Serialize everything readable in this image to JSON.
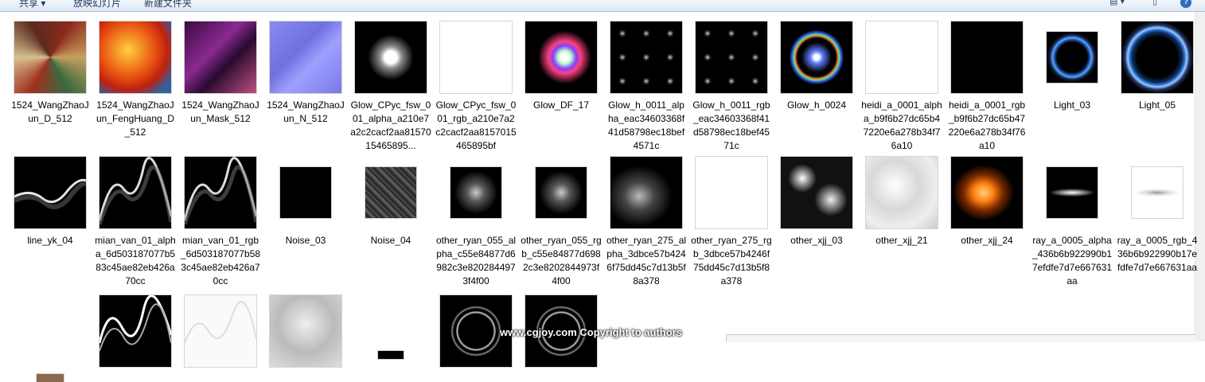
{
  "toolbar": {
    "share": "共享 ▾",
    "slideshow": "放映幻灯片",
    "new_folder": "新建文件夹",
    "view_icon": "▤ ▾",
    "pane_icon": "▯",
    "help": "?"
  },
  "row1": [
    {
      "name": "1524_WangZhaoJun_D_512",
      "thumb": "tex-d"
    },
    {
      "name": "1524_WangZhaoJun_FengHuang_D_512",
      "thumb": "tex-feng"
    },
    {
      "name": "1524_WangZhaoJun_Mask_512",
      "thumb": "tex-mask"
    },
    {
      "name": "1524_WangZhaoJun_N_512",
      "thumb": "tex-normal"
    },
    {
      "name": "Glow_CPyc_fsw_001_alpha_a210e7a2c2cacf2aa8157015465895...",
      "thumb": "glow-white"
    },
    {
      "name": "Glow_CPyc_fsw_001_rgb_a210e7a2c2cacf2aa8157015465895bf",
      "thumb": "white"
    },
    {
      "name": "Glow_DF_17",
      "thumb": "glow-rainbow"
    },
    {
      "name": "Glow_h_0011_alpha_eac34603368f41d58798ec18bef4571c",
      "thumb": "dots"
    },
    {
      "name": "Glow_h_0011_rgb_eac34603368f41d58798ec18bef4571c",
      "thumb": "dots"
    },
    {
      "name": "Glow_h_0024",
      "thumb": "ring-rainbow"
    },
    {
      "name": "heidi_a_0001_alpha_b9f6b27dc65b47220e6a278b34f76a10",
      "thumb": "white"
    },
    {
      "name": "heidi_a_0001_rgb_b9f6b27dc65b47220e6a278b34f76a10",
      "thumb": "black"
    },
    {
      "name": "Light_03",
      "thumb": "ring-blue-small"
    },
    {
      "name": "Light_05",
      "thumb": "ring-blue"
    }
  ],
  "row2": [
    {
      "name": "line_yk_04",
      "thumb": "wave"
    },
    {
      "name": "mian_van_01_alpha_6d503187077b583c45ae82eb426a70cc",
      "thumb": "wave2"
    },
    {
      "name": "mian_van_01_rgb_6d503187077b583c45ae82eb426a70cc",
      "thumb": "wave2"
    },
    {
      "name": "Noise_03",
      "thumb": "black-small"
    },
    {
      "name": "Noise_04",
      "thumb": "noise-tile"
    },
    {
      "name": "other_ryan_055_alpha_c55e84877d6982c3e8202844973f4f00",
      "thumb": "smoke-small"
    },
    {
      "name": "other_ryan_055_rgb_c55e84877d6982c3e8202844973f4f00",
      "thumb": "smoke-small"
    },
    {
      "name": "other_ryan_275_alpha_3dbce57b4246f75dd45c7d13b5f8a378",
      "thumb": "smoke"
    },
    {
      "name": "other_ryan_275_rgb_3dbce57b4246f75dd45c7d13b5f8a378",
      "thumb": "white"
    },
    {
      "name": "other_xjj_03",
      "thumb": "caustic"
    },
    {
      "name": "other_xjj_21",
      "thumb": "cloud"
    },
    {
      "name": "other_xjj_24",
      "thumb": "fire"
    },
    {
      "name": "ray_a_0005_alpha_436b6b922990b17efdfe7d7e667631aa",
      "thumb": "ray-dark"
    },
    {
      "name": "ray_a_0005_rgb_436b6b922990b17efdfe7d7e667631aa",
      "thumb": "ray-light"
    }
  ],
  "row3": [
    {
      "name": "",
      "thumb": "partial-a"
    },
    {
      "name": "",
      "thumb": "wave3"
    },
    {
      "name": "",
      "thumb": "lightwave"
    },
    {
      "name": "",
      "thumb": "grey-blob"
    },
    {
      "name": "",
      "thumb": "black-tiny"
    },
    {
      "name": "",
      "thumb": "rings"
    },
    {
      "name": "",
      "thumb": "rings"
    }
  ],
  "watermark": "www.cgjoy.com Copyright to authors"
}
